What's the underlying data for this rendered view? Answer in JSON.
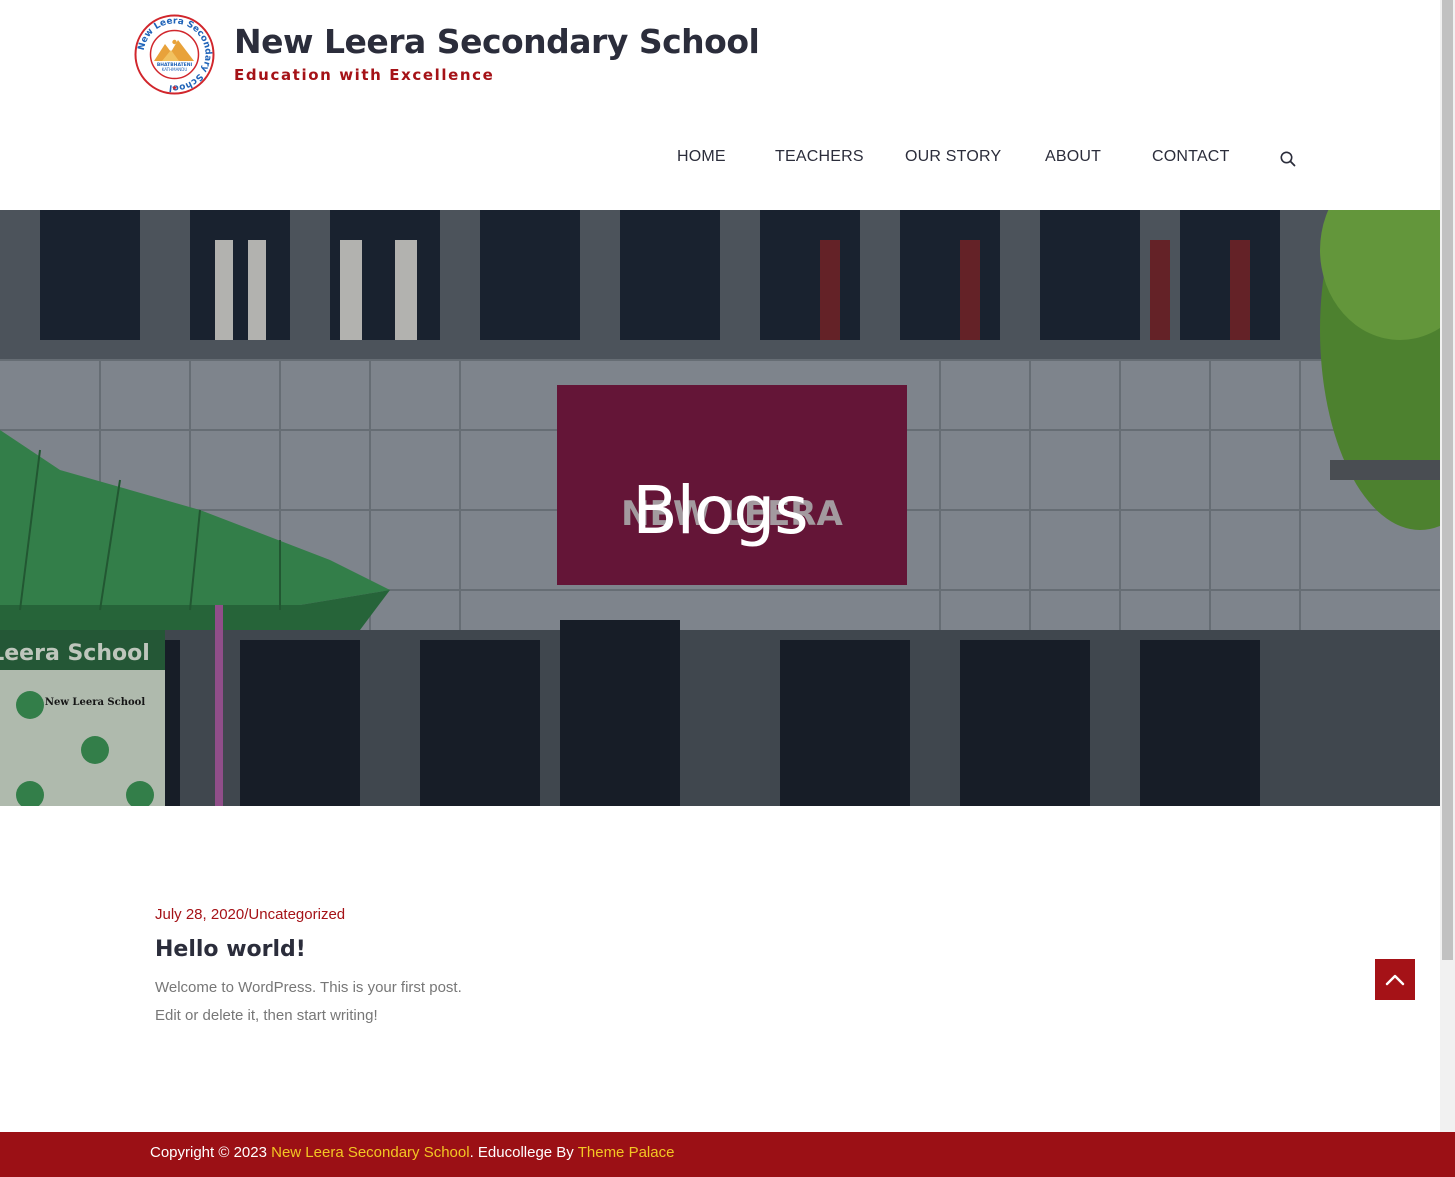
{
  "colors": {
    "brand_red": "#a51217",
    "footer_bg": "#9b1015",
    "footer_link": "#f3c623",
    "heading_dark": "#2b2d3b",
    "body_gray": "#777777"
  },
  "header": {
    "site_title": "New Leera Secondary School",
    "tagline": "Education with Excellence",
    "logo": {
      "ring_text": "New Leera Secondary School",
      "center_text_1": "BHATBHATENI",
      "center_text_2": "KATHMANDU",
      "icon": "mountain-logo-icon"
    }
  },
  "nav": {
    "items": [
      {
        "label": "Home"
      },
      {
        "label": "Teachers"
      },
      {
        "label": "Our Story"
      },
      {
        "label": "About"
      },
      {
        "label": "Contact"
      }
    ],
    "search_icon": "search-icon"
  },
  "hero": {
    "title": "Blogs",
    "sign_text": "NEW LEERA",
    "banner_text": "Leera School",
    "poster_text": "New Leera School"
  },
  "post": {
    "date": "July 28, 2020",
    "separator": "/",
    "category": "Uncategorized",
    "title": "Hello world!",
    "excerpt_line1": "Welcome to WordPress. This is your first post.",
    "excerpt_line2": "Edit or delete it, then start writing!"
  },
  "back_to_top_icon": "chevron-up-icon",
  "footer": {
    "prefix": "Copyright © 2023 ",
    "site_link": "New Leera Secondary School",
    "middle": ". Educollege By ",
    "theme_link": "Theme Palace"
  }
}
